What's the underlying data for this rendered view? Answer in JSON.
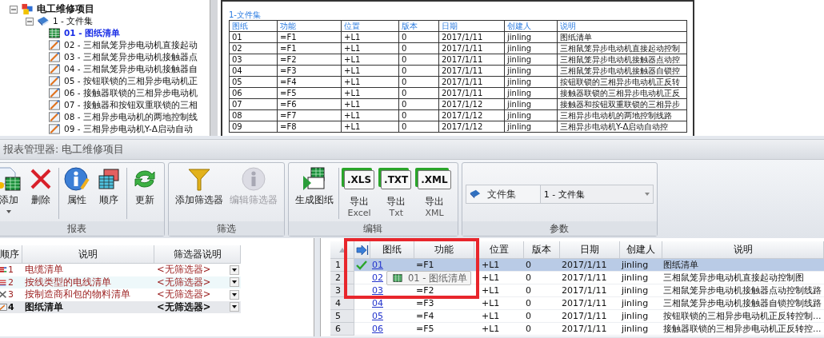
{
  "tree": {
    "label": "电工维修项目",
    "expanded": true,
    "children": [
      {
        "label": "1 - 文件集",
        "expanded": true,
        "children": [
          {
            "label": "01 - 图纸清单",
            "kind": "list",
            "selected": true
          },
          {
            "label": "02 - 三相鼠笼异步电动机直接起动",
            "kind": "drawing",
            "selected": false
          },
          {
            "label": "03 - 三相鼠笼异步电动机接触器点",
            "kind": "drawing",
            "selected": false
          },
          {
            "label": "04 - 三相鼠笼异步电动机接触器自",
            "kind": "drawing",
            "selected": false
          },
          {
            "label": "05 - 按钮联锁的三相异步电动机正",
            "kind": "drawing",
            "selected": false
          },
          {
            "label": "06 - 接触器联锁的三相异步电动机",
            "kind": "drawing",
            "selected": false
          },
          {
            "label": "07 - 接触器和按钮双重联锁的三相",
            "kind": "drawing",
            "selected": false
          },
          {
            "label": "08 - 三相异步电动机的两地控制线",
            "kind": "drawing",
            "selected": false
          },
          {
            "label": "09 - 三相异步电动机Y-Δ启动自动",
            "kind": "drawing",
            "selected": false
          }
        ]
      }
    ]
  },
  "preview": {
    "title": "1-文件集",
    "columns": [
      "图纸",
      "功能",
      "位置",
      "版本",
      "日期",
      "创建人",
      "说明"
    ],
    "rows": [
      [
        "01",
        "=F1",
        "+L1",
        "0",
        "2017/1/11",
        "jinling",
        "图纸清单"
      ],
      [
        "02",
        "=F1",
        "+L1",
        "0",
        "2017/1/11",
        "jinling",
        "三相鼠笼异步电动机直接起动控制"
      ],
      [
        "03",
        "=F2",
        "+L1",
        "0",
        "2017/1/11",
        "jinling",
        "三相鼠笼异步电动机接触器点动控"
      ],
      [
        "04",
        "=F3",
        "+L1",
        "0",
        "2017/1/11",
        "jinling",
        "三相鼠笼异步电动机接触器自锁控"
      ],
      [
        "05",
        "=F4",
        "+L1",
        "0",
        "2017/1/11",
        "jinling",
        "按钮联锁的三相异步电动机正反转"
      ],
      [
        "06",
        "=F5",
        "+L1",
        "0",
        "2017/1/11",
        "jinling",
        "接触器联锁的三相异步电动机正反"
      ],
      [
        "07",
        "=F6",
        "+L1",
        "0",
        "2017/1/12",
        "jinling",
        "接触器和按钮双重联锁的三相异步"
      ],
      [
        "08",
        "=F7",
        "+L1",
        "0",
        "2017/1/12",
        "jinling",
        "三相异步电动机的两地控制线路"
      ],
      [
        "09",
        "=F8",
        "+L1",
        "0",
        "2017/1/12",
        "jinling",
        "三相异步电动机Y-Δ启动自动控"
      ]
    ]
  },
  "manager_title": "报表管理器: 电工维修项目",
  "ribbon": {
    "groups": [
      {
        "label": "报表",
        "buttons": [
          {
            "label": "添加",
            "kind": "add",
            "dropdown": true,
            "disabled": false
          },
          {
            "label": "删除",
            "kind": "delete",
            "disabled": false,
            "separator_after": true
          },
          {
            "label": "属性",
            "kind": "properties",
            "disabled": false
          },
          {
            "label": "顺序",
            "kind": "order",
            "disabled": false,
            "separator_after": true
          },
          {
            "label": "更新",
            "kind": "refresh",
            "disabled": false
          }
        ]
      },
      {
        "label": "筛选",
        "buttons": [
          {
            "label": "添加筛选器",
            "kind": "filter",
            "disabled": false
          },
          {
            "label": "编辑筛选器",
            "kind": "info",
            "disabled": true
          }
        ]
      },
      {
        "label": "编辑",
        "buttons": [
          {
            "label": "生成图纸",
            "kind": "generate",
            "disabled": false,
            "separator_after": true
          },
          {
            "label": "导出",
            "sublabel": "Excel",
            "kind": "file",
            "badge": ".XLS",
            "disabled": false
          },
          {
            "label": "导出",
            "sublabel": "Txt",
            "kind": "file",
            "badge": ".TXT",
            "disabled": false
          },
          {
            "label": "导出",
            "sublabel": "XML",
            "kind": "file",
            "badge": ".XML",
            "disabled": false
          }
        ]
      },
      {
        "label": "参数",
        "combo": {
          "label": "文件集",
          "value": "1 - 文件集"
        }
      }
    ]
  },
  "reports": {
    "columns": [
      "顺序",
      "说明",
      "筛选器说明"
    ],
    "rows": [
      {
        "order": "1",
        "kind": "cable",
        "description": "电缆清单",
        "filter": "<无筛选器>",
        "selected": false
      },
      {
        "order": "2",
        "kind": "wire",
        "description": "按线类型的电线清单",
        "filter": "<无筛选器>",
        "selected": false
      },
      {
        "order": "3",
        "kind": "material",
        "description": "按制造商和包的物料清单",
        "filter": "<无筛选器>",
        "selected": false
      },
      {
        "order": "4",
        "kind": "drawing",
        "description": "图纸清单",
        "filter": "<无筛选器>",
        "selected": true
      }
    ]
  },
  "drawings": {
    "columns": [
      "图纸",
      "功能",
      "位置",
      "版本",
      "日期",
      "创建人",
      "说明"
    ],
    "rows": [
      {
        "number": "1",
        "checked": true,
        "selected": true,
        "drawing": "01",
        "function": "=F1",
        "location": "+L1",
        "version": "0",
        "date": "2017/1/11",
        "creator": "jinling",
        "description": "图纸清单"
      },
      {
        "number": "2",
        "checked": false,
        "selected": false,
        "drawing": "02",
        "location": "+L1",
        "version": "0",
        "date": "2017/1/11",
        "creator": "jinling",
        "description": "三相鼠笼异步电动机直接起动控制图"
      },
      {
        "number": "3",
        "checked": false,
        "selected": false,
        "drawing": "03",
        "function": "=F2",
        "location": "+L1",
        "version": "0",
        "date": "2017/1/11",
        "creator": "jinling",
        "description": "三相鼠笼异步电动机接触器点动控制线路"
      },
      {
        "number": "4",
        "checked": false,
        "selected": false,
        "drawing": "04",
        "function": "=F3",
        "location": "+L1",
        "version": "0",
        "date": "2017/1/11",
        "creator": "jinling",
        "description": "三相鼠笼异步电动机接触器自锁控制线路"
      },
      {
        "number": "5",
        "checked": false,
        "selected": false,
        "drawing": "05",
        "function": "=F4",
        "location": "+L1",
        "version": "0",
        "date": "2017/1/11",
        "creator": "jinling",
        "description": "按钮联锁的三相异步电动机正反转控制…"
      },
      {
        "number": "6",
        "checked": false,
        "selected": false,
        "drawing": "06",
        "function": "=F5",
        "location": "+L1",
        "version": "0",
        "date": "2017/1/11",
        "creator": "jinling",
        "description": "接触器联锁的三相异步电动机正反转控…"
      }
    ],
    "tooltip": "01 - 图纸清单"
  }
}
